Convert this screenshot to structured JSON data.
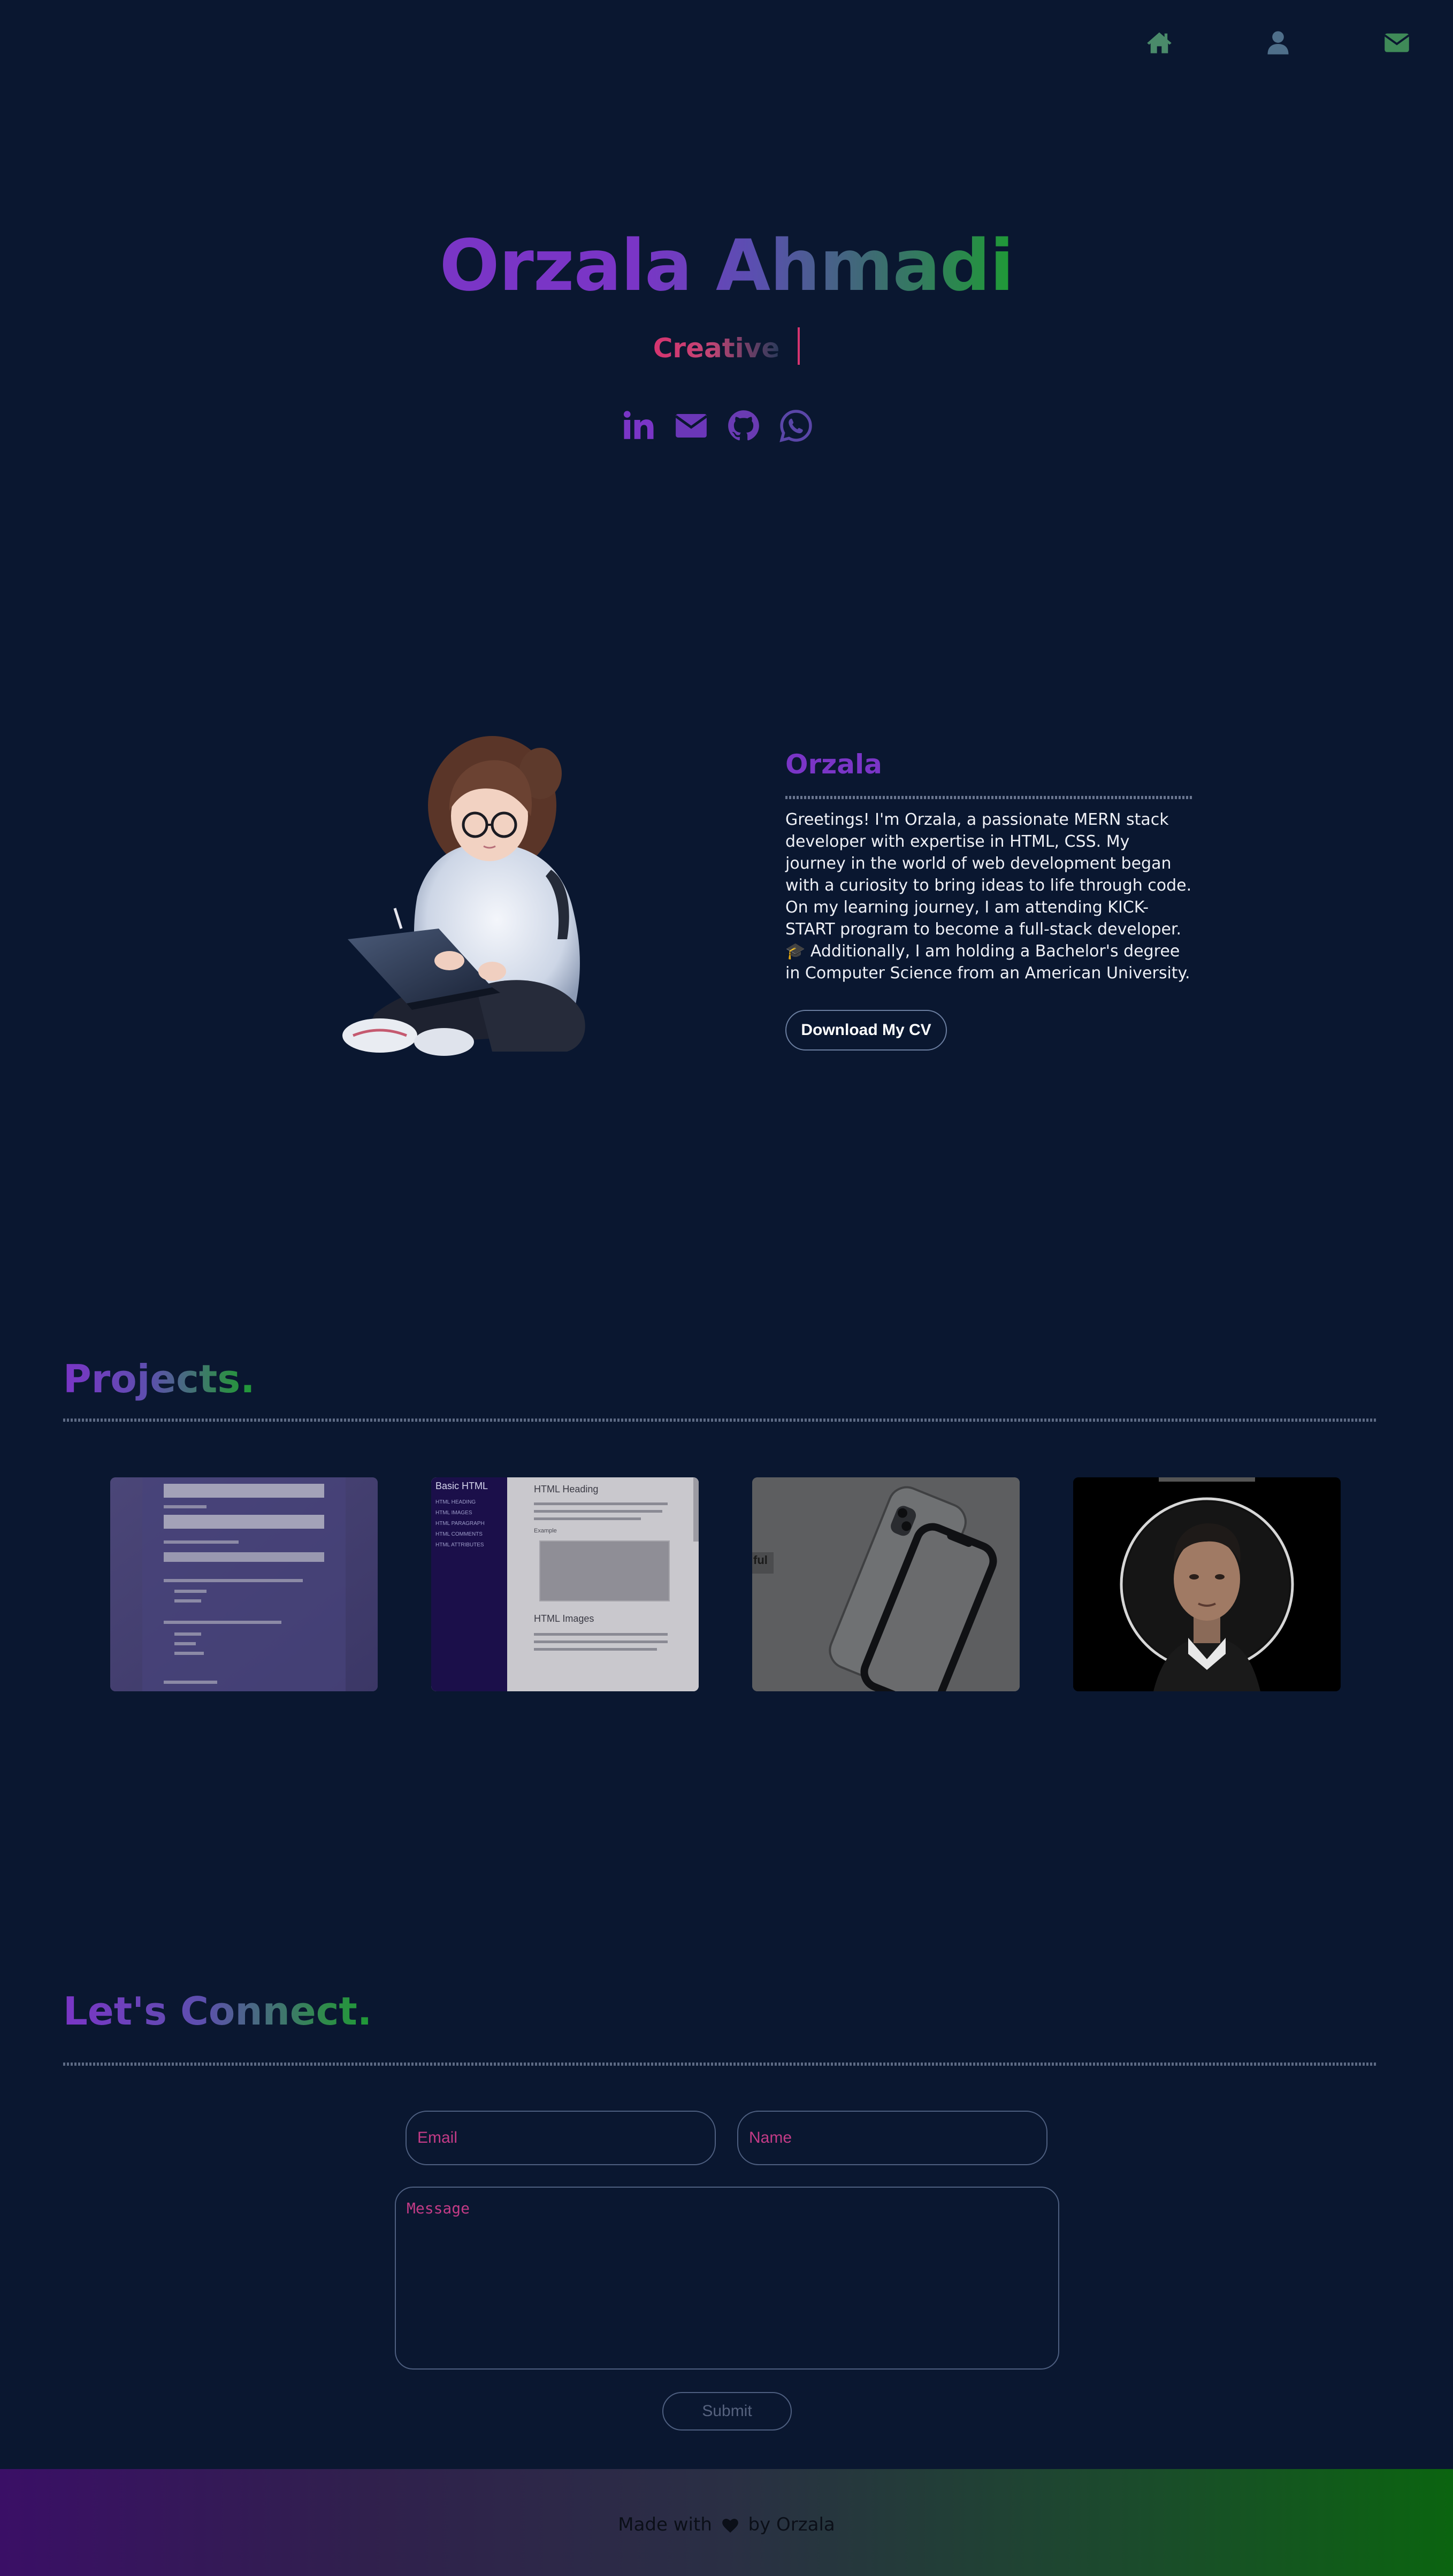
{
  "nav": {
    "items": [
      {
        "icon": "home-icon"
      },
      {
        "icon": "user-icon"
      },
      {
        "icon": "envelope-icon"
      }
    ],
    "color": "#4a8a6a"
  },
  "hero": {
    "name": "Orzala Ahmadi",
    "typed_text": "Creative",
    "socials": [
      {
        "icon": "linkedin-icon"
      },
      {
        "icon": "email-icon"
      },
      {
        "icon": "github-icon"
      },
      {
        "icon": "whatsapp-icon"
      }
    ],
    "accent": "#7a35c6"
  },
  "about": {
    "heading": "Orzala",
    "bio": "Greetings! I'm Orzala, a passionate MERN stack developer with expertise in HTML, CSS. My journey in the world of web development began with a curiosity to bring ideas to life through code. On my learning journey, I am attending KICK-START program to become a full-stack developer. 🎓 Additionally, I am holding a Bachelor's degree in Computer Science from an American University.",
    "cv_button": "Download My CV"
  },
  "projects": {
    "title": "Projects.",
    "cards": [
      {
        "name": "form-survey-project",
        "kind": "form"
      },
      {
        "name": "basic-html-docs-project",
        "kind": "docs",
        "sidebar_title": "Basic HTML",
        "sidebar_items": [
          "HTML HEADING",
          "HTML IMAGES",
          "HTML PARAGRAPH",
          "HTML COMMENTS",
          "HTML ATTRIBUTES"
        ],
        "heading1": "HTML Heading",
        "heading2": "HTML Images",
        "example": "Example"
      },
      {
        "name": "phone-landing-project",
        "kind": "phone"
      },
      {
        "name": "tribute-page-project",
        "kind": "portrait"
      }
    ]
  },
  "contact": {
    "title": "Let's Connect.",
    "email_placeholder": "Email",
    "name_placeholder": "Name",
    "message_placeholder": "Message",
    "submit_label": "Submit"
  },
  "footer": {
    "made_with": "Made with",
    "by": "by Orzala"
  }
}
